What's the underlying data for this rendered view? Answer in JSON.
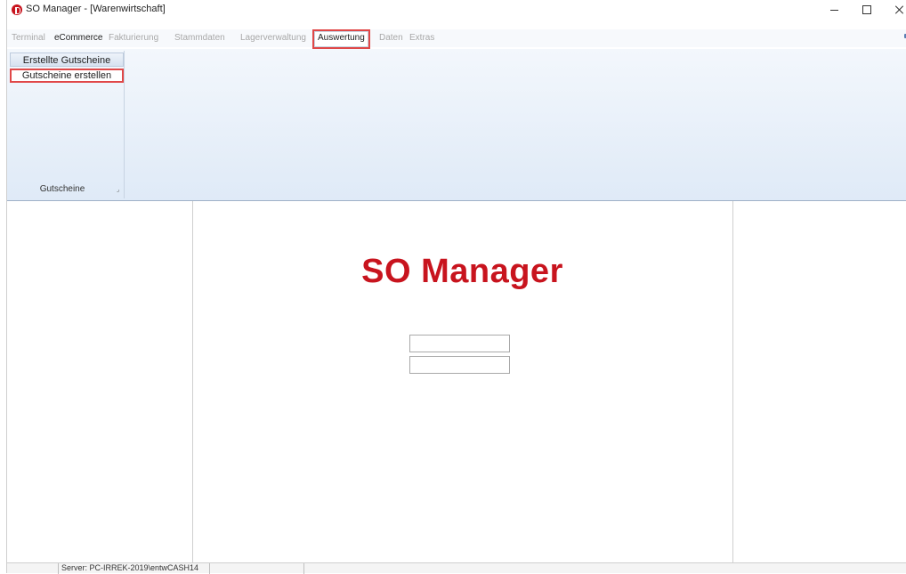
{
  "window": {
    "title": "SO Manager - [Warenwirtschaft]"
  },
  "ribbon": {
    "tabs": [
      {
        "label": "Terminal"
      },
      {
        "label": "eCommerce"
      },
      {
        "label": "Fakturierung"
      },
      {
        "label": "Stammdaten"
      },
      {
        "label": "Lagerverwaltung"
      },
      {
        "label": "Auswertung"
      },
      {
        "label": "Daten"
      },
      {
        "label": "Extras"
      }
    ],
    "group": {
      "label": "Gutscheine",
      "buttons": [
        {
          "label": "Erstellte Gutscheine"
        },
        {
          "label": "Gutscheine erstellen"
        }
      ]
    }
  },
  "content": {
    "brand": "SO Manager",
    "field1": "",
    "field2": ""
  },
  "statusbar": {
    "server": "Server: PC-IRREK-2019\\entwCASH14"
  },
  "colors": {
    "brand_red": "#c8141e",
    "highlight_red": "#e04848",
    "ribbon_blue": "#dfeaf7"
  }
}
